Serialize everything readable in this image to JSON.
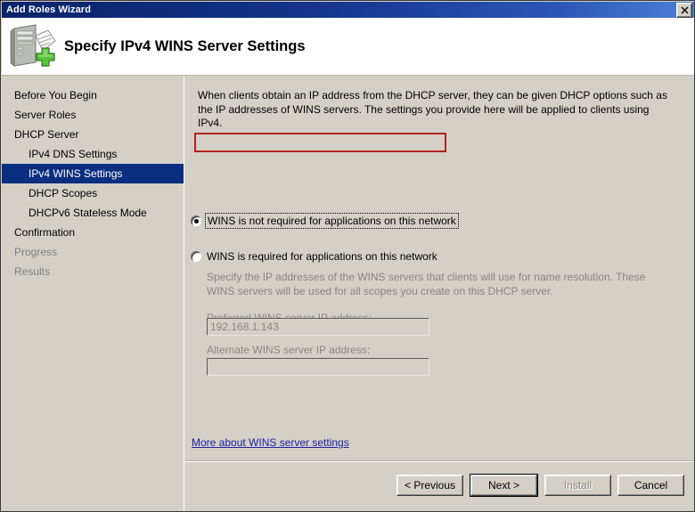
{
  "window": {
    "title": "Add Roles Wizard",
    "close_label": "✕"
  },
  "header": {
    "title": "Specify IPv4 WINS Server Settings",
    "icon": "server-add-icon"
  },
  "sidebar": {
    "items": [
      {
        "label": "Before You Begin",
        "level": 0,
        "state": "normal"
      },
      {
        "label": "Server Roles",
        "level": 0,
        "state": "normal"
      },
      {
        "label": "DHCP Server",
        "level": 0,
        "state": "normal"
      },
      {
        "label": "IPv4 DNS Settings",
        "level": 1,
        "state": "normal"
      },
      {
        "label": "IPv4 WINS Settings",
        "level": 1,
        "state": "selected"
      },
      {
        "label": "DHCP Scopes",
        "level": 1,
        "state": "normal"
      },
      {
        "label": "DHCPv6 Stateless Mode",
        "level": 1,
        "state": "normal"
      },
      {
        "label": "Confirmation",
        "level": 0,
        "state": "normal"
      },
      {
        "label": "Progress",
        "level": 0,
        "state": "dim"
      },
      {
        "label": "Results",
        "level": 0,
        "state": "dim"
      }
    ]
  },
  "main": {
    "intro": "When clients obtain an IP address from the DHCP server, they can be given DHCP options such as the IP addresses of WINS servers. The settings you provide here will be applied to clients using IPv4.",
    "option_not_required": {
      "label": "WINS is not required for applications on this network",
      "selected": true,
      "focused": true,
      "highlight_color": "#b32020"
    },
    "option_required": {
      "label": "WINS is required for applications on this network",
      "selected": false
    },
    "sub_description": "Specify the IP addresses of the WINS servers that clients will use for name resolution. These WINS servers will be used for all scopes you create on this DHCP server.",
    "preferred_label": "Preferred WINS server IP address:",
    "preferred_value": "192.168.1.143",
    "alternate_label": "Alternate WINS server IP address:",
    "alternate_value": "",
    "more_link": "More about WINS server settings"
  },
  "footer": {
    "previous_label": "< Previous",
    "next_label": "Next >",
    "install_label": "Install",
    "cancel_label": "Cancel"
  }
}
